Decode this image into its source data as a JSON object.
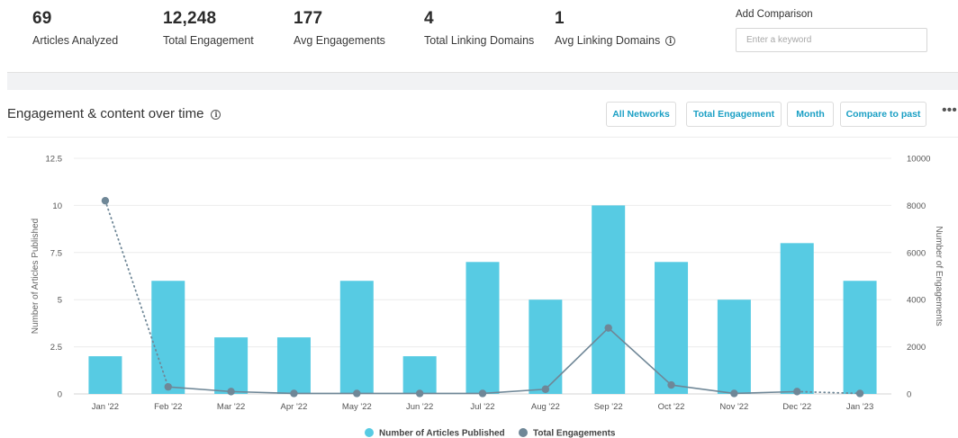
{
  "stats": [
    {
      "value": "69",
      "label": "Articles Analyzed"
    },
    {
      "value": "12,248",
      "label": "Total Engagement"
    },
    {
      "value": "177",
      "label": "Avg Engagements"
    },
    {
      "value": "4",
      "label": "Total Linking Domains"
    },
    {
      "value": "1",
      "label": "Avg Linking Domains"
    }
  ],
  "compare": {
    "label": "Add Comparison",
    "placeholder": "Enter a keyword"
  },
  "card": {
    "title": "Engagement & content over time",
    "buttons": {
      "networks": "All Networks",
      "metric": "Total Engagement",
      "period": "Month",
      "compare": "Compare to past"
    },
    "more": "•••"
  },
  "colors": {
    "bar": "#57cbe3",
    "line": "#6f8797",
    "accent": "#1a9fc4"
  },
  "chart_data": {
    "type": "bar",
    "categories": [
      "Jan '22",
      "Feb '22",
      "Mar '22",
      "Apr '22",
      "May '22",
      "Jun '22",
      "Jul '22",
      "Aug '22",
      "Sep '22",
      "Oct '22",
      "Nov '22",
      "Dec '22",
      "Jan '23"
    ],
    "series": [
      {
        "name": "Number of Articles Published",
        "type": "bar",
        "axis": "left",
        "values": [
          2,
          6,
          3,
          3,
          6,
          2,
          7,
          5,
          10,
          7,
          5,
          8,
          6
        ]
      },
      {
        "name": "Total Engagements",
        "type": "line",
        "axis": "right",
        "values": [
          8200,
          300,
          100,
          20,
          20,
          20,
          20,
          200,
          2800,
          380,
          20,
          100,
          20
        ],
        "dotted_segments": [
          [
            0,
            1
          ],
          [
            11,
            12
          ]
        ]
      }
    ],
    "ylabel": "Number of Articles Published",
    "y2label": "Number of Engagements",
    "yticks": [
      "0",
      "2.5",
      "5",
      "7.5",
      "10",
      "12.5"
    ],
    "ylim": [
      0,
      12.5
    ],
    "y2ticks": [
      "0",
      "2000",
      "4000",
      "6000",
      "8000",
      "10000"
    ],
    "y2lim": [
      0,
      10000
    ],
    "grid": true,
    "legend": "bottom-center"
  }
}
